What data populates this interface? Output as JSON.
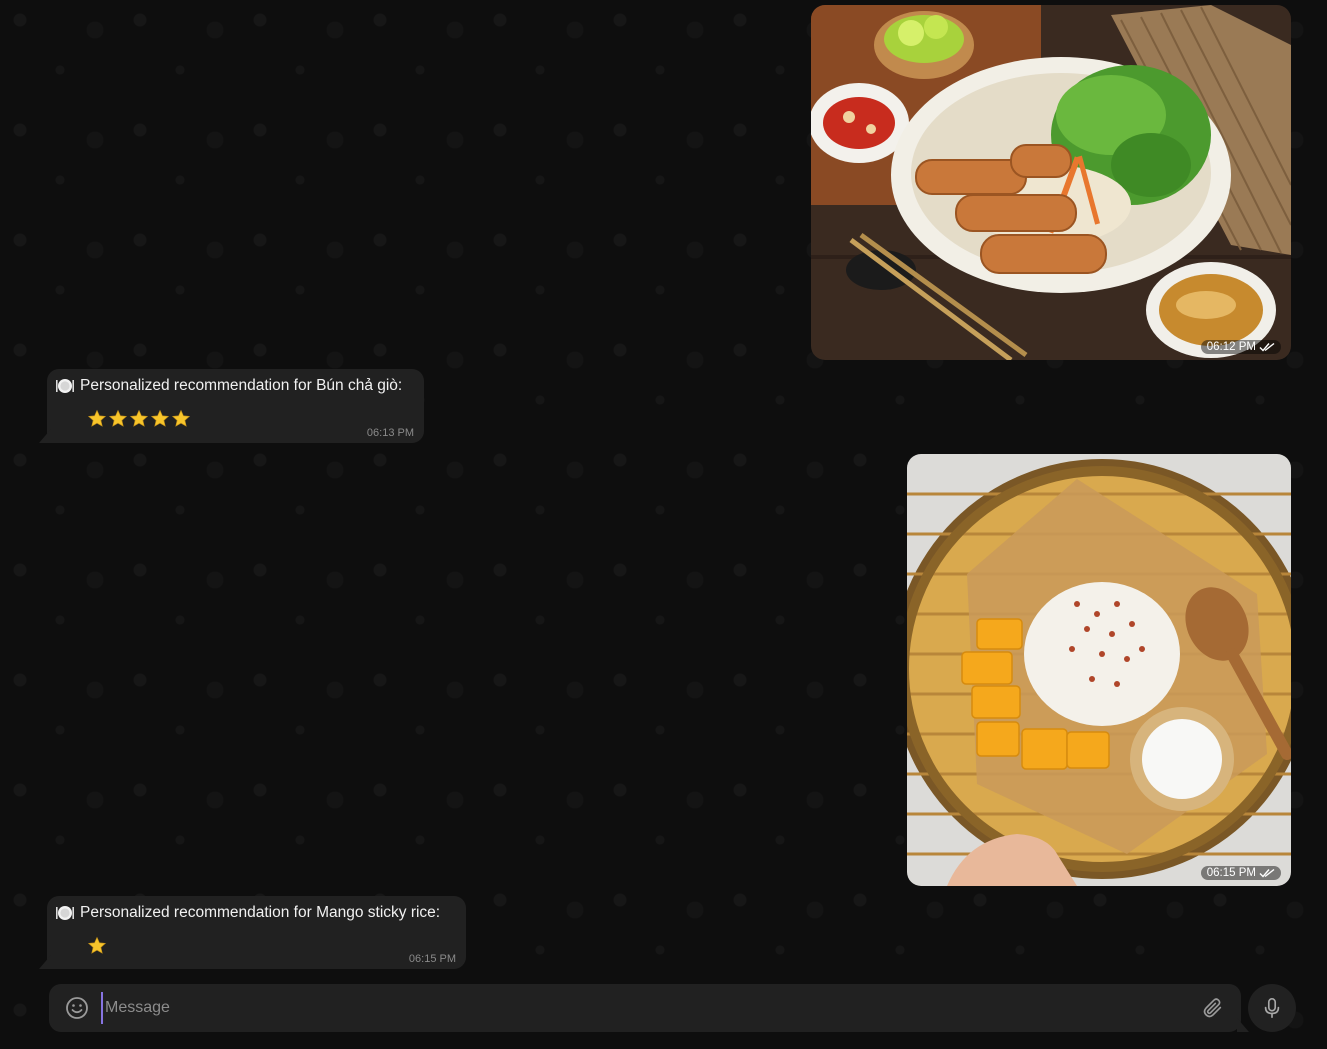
{
  "messages": [
    {
      "type": "photo",
      "direction": "outgoing",
      "subject": "Bún chả giò",
      "time": "06:12 PM",
      "status": "read"
    },
    {
      "type": "text",
      "direction": "incoming",
      "icon": "plate-icon",
      "text": "Personalized recommendation for Bún chả giò:",
      "rating": 5,
      "time": "06:13 PM"
    },
    {
      "type": "photo",
      "direction": "outgoing",
      "subject": "Mango sticky rice",
      "time": "06:15 PM",
      "status": "read"
    },
    {
      "type": "text",
      "direction": "incoming",
      "icon": "plate-icon",
      "text": "Personalized recommendation for Mango sticky rice:",
      "rating": 1,
      "time": "06:15 PM"
    }
  ],
  "composer": {
    "placeholder": "Message",
    "value": ""
  },
  "icons": {
    "emoji": "smiley-icon",
    "attach": "paperclip-icon",
    "voice": "microphone-icon",
    "read_status": "double-check-icon",
    "rating": "star-icon"
  },
  "colors": {
    "background": "#0e0e0e",
    "bubble": "#212121",
    "accent": "#8774e1",
    "star": "#f7c52b"
  }
}
